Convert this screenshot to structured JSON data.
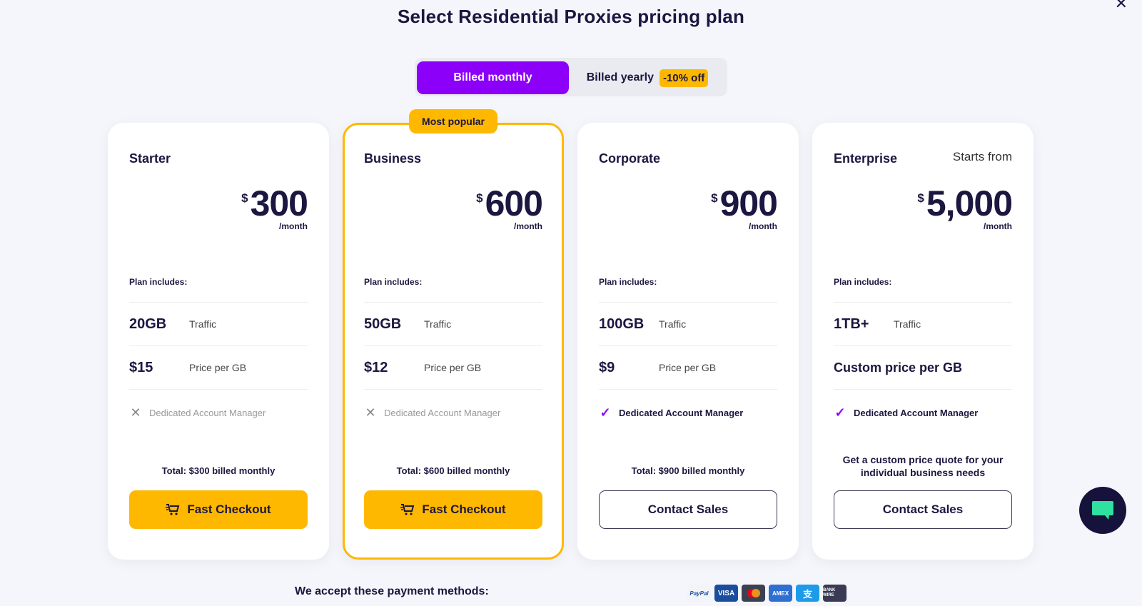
{
  "page": {
    "title": "Select Residential Proxies pricing plan",
    "close_icon": "close-icon"
  },
  "billing_toggle": {
    "monthly_label": "Billed monthly",
    "yearly_label": "Billed yearly",
    "yearly_discount": "-10% off",
    "selected": "monthly"
  },
  "colors": {
    "accent_purple": "#8c00f9",
    "accent_yellow": "#ffb800",
    "text_dark": "#1b1740",
    "chat_bg": "#15123b",
    "chat_icon": "#2fe0a0"
  },
  "plans": [
    {
      "name": "Starter",
      "starts_from": "",
      "currency": "$",
      "price": "300",
      "period": "/month",
      "includes_label": "Plan includes:",
      "traffic_value": "20GB",
      "traffic_label": "Traffic",
      "price_per_gb_value": "$15",
      "price_per_gb_label": "Price per GB",
      "manager_label": "Dedicated Account Manager",
      "manager_included": false,
      "total": "Total: $300 billed monthly",
      "button_label": "Fast Checkout",
      "button_icon": "cart-icon"
    },
    {
      "name": "Business",
      "badge": "Most popular",
      "currency": "$",
      "price": "600",
      "period": "/month",
      "includes_label": "Plan includes:",
      "traffic_value": "50GB",
      "traffic_label": "Traffic",
      "price_per_gb_value": "$12",
      "price_per_gb_label": "Price per GB",
      "manager_label": "Dedicated Account Manager",
      "manager_included": false,
      "total": "Total: $600 billed monthly",
      "button_label": "Fast Checkout",
      "button_icon": "cart-icon"
    },
    {
      "name": "Corporate",
      "currency": "$",
      "price": "900",
      "period": "/month",
      "includes_label": "Plan includes:",
      "traffic_value": "100GB",
      "traffic_label": "Traffic",
      "price_per_gb_value": "$9",
      "price_per_gb_label": "Price per GB",
      "manager_label": "Dedicated Account Manager",
      "manager_included": true,
      "total": "Total: $900 billed monthly",
      "button_label": "Contact Sales"
    },
    {
      "name": "Enterprise",
      "starts_from": "Starts from",
      "currency": "$",
      "price": "5,000",
      "period": "/month",
      "includes_label": "Plan includes:",
      "traffic_value": "1TB+",
      "traffic_label": "Traffic",
      "price_per_gb_full": "Custom price per GB",
      "manager_label": "Dedicated Account Manager",
      "manager_included": true,
      "quote": "Get a custom price quote for your individual business needs",
      "button_label": "Contact Sales"
    }
  ],
  "payments": {
    "label": "We accept these payment methods:",
    "methods": [
      "PayPal",
      "VISA",
      "Mastercard",
      "AMEX",
      "Alipay",
      "BANK WIRE"
    ]
  }
}
